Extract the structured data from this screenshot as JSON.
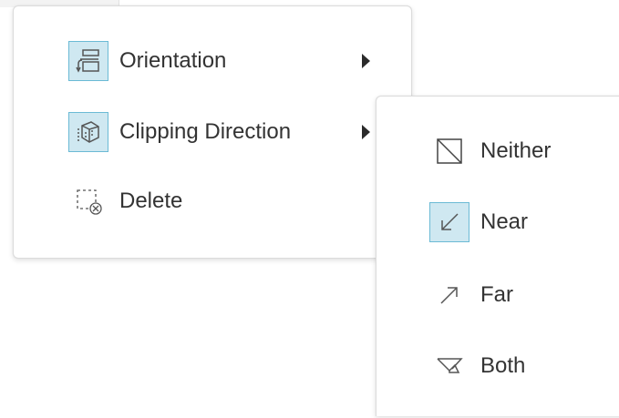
{
  "main_menu": {
    "items": [
      {
        "label": "Orientation",
        "icon": "orientation-icon",
        "has_submenu": true,
        "selected": true
      },
      {
        "label": "Clipping Direction",
        "icon": "clipping-direction-icon",
        "has_submenu": true,
        "selected": true
      },
      {
        "label": "Delete",
        "icon": "delete-icon",
        "has_submenu": false,
        "selected": false
      }
    ]
  },
  "sub_menu": {
    "items": [
      {
        "label": "Neither",
        "icon": "neither-icon",
        "selected": false
      },
      {
        "label": "Near",
        "icon": "near-arrow-icon",
        "selected": true
      },
      {
        "label": "Far",
        "icon": "far-arrow-icon",
        "selected": false
      },
      {
        "label": "Both",
        "icon": "both-icon",
        "selected": false
      }
    ]
  },
  "colors": {
    "selected_fill": "#cfe8f1",
    "selected_border": "#6bbad5",
    "text": "#333333"
  }
}
